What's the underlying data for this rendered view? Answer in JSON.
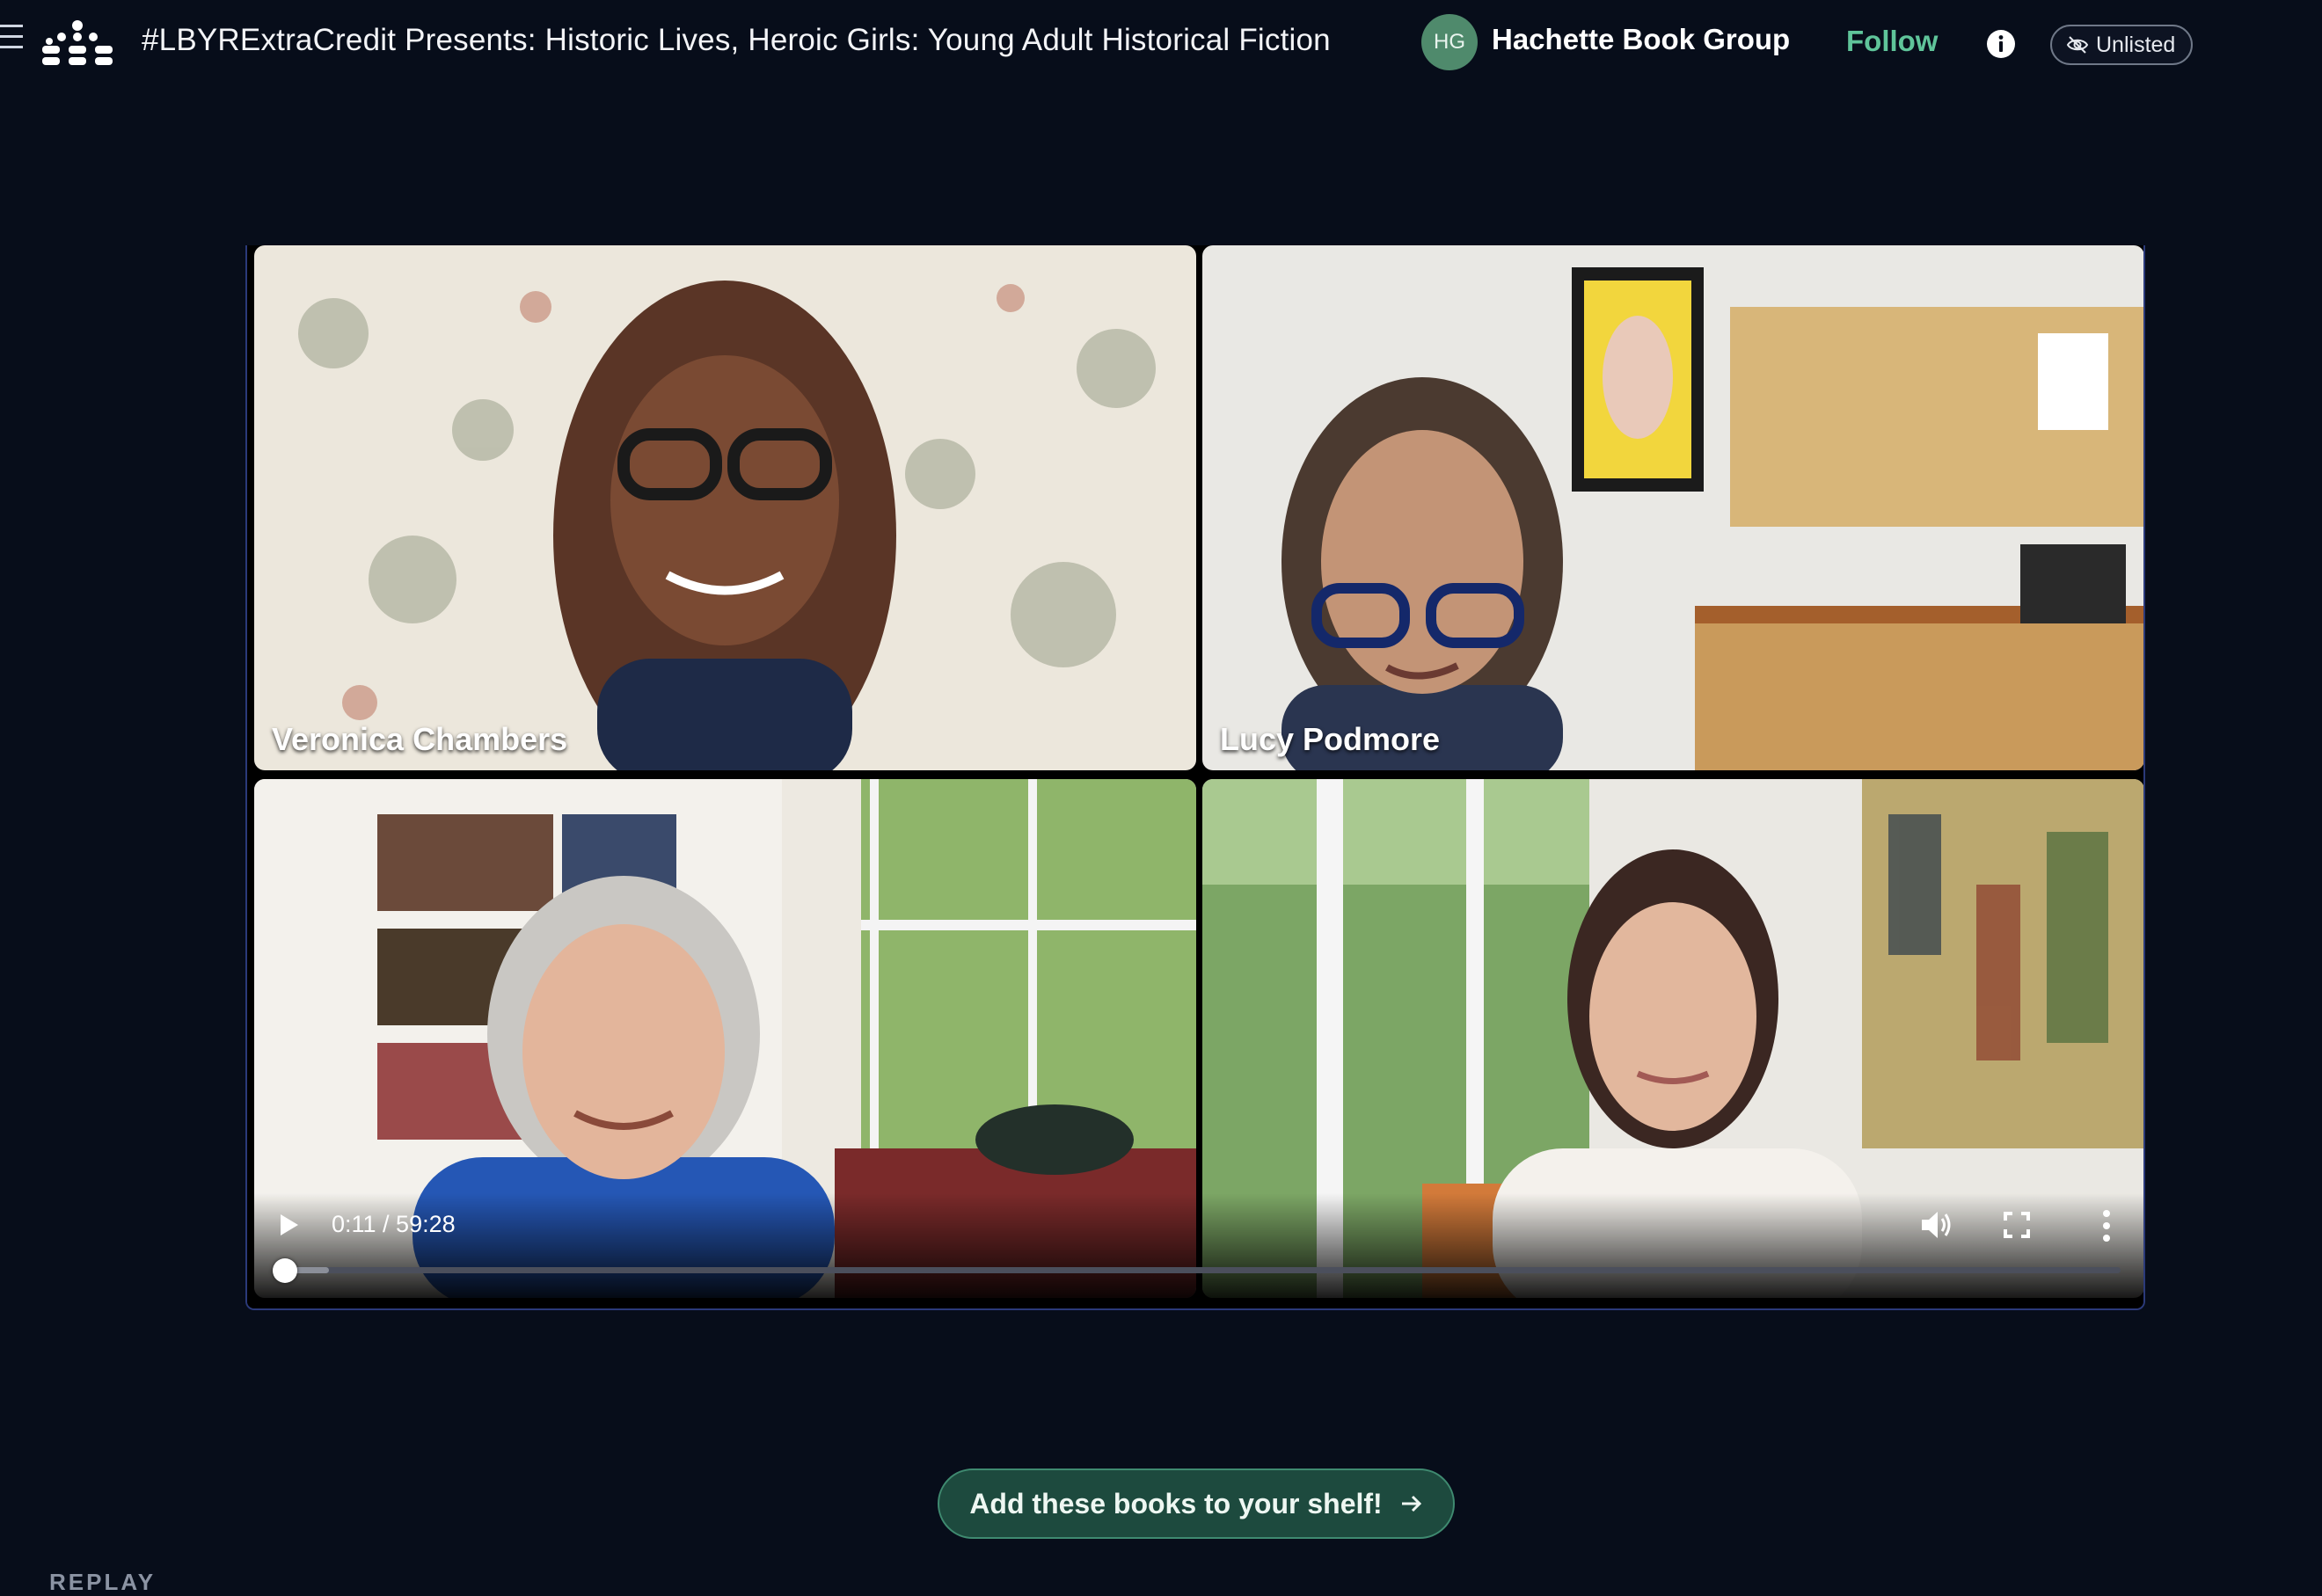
{
  "header": {
    "title": "#LBYRExtraCredit Presents: Historic Lives, Heroic Girls: Young Adult Historical Fiction",
    "avatar_initials": "HG",
    "org_name": "Hachette Book Group",
    "follow_label": "Follow",
    "visibility_label": "Unlisted",
    "icons": [
      "menu-icon",
      "logo-icon",
      "info-icon",
      "eye-off-icon"
    ]
  },
  "video": {
    "participants": [
      {
        "name": "Veronica Chambers"
      },
      {
        "name": "Lucy Podmore"
      }
    ],
    "current_time": "0:11",
    "duration": "59:28",
    "time_display": "0:11 / 59:28",
    "progress_fraction": 0.0031,
    "buffered_fraction": 0.03,
    "icons": [
      "play-icon",
      "volume-icon",
      "fullscreen-icon",
      "more-options-icon"
    ]
  },
  "cta": {
    "label": "Add these books to your shelf!",
    "icon": "arrow-right-icon"
  },
  "section": {
    "label": "REPLAY"
  },
  "colors": {
    "background": "#070d1a",
    "accent": "#5fc49a",
    "avatar": "#4f8a6c",
    "cta_background": "#1d4a3e",
    "player_border": "#2b3a7a"
  }
}
